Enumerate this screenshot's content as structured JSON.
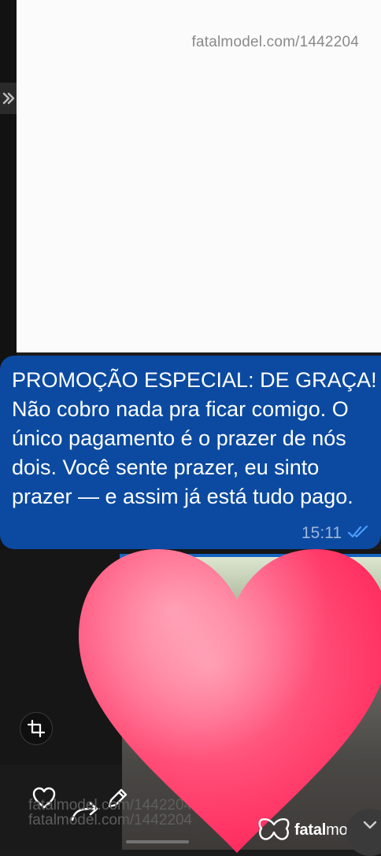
{
  "top_image": {
    "watermark": "fatalmodel.com/1442204"
  },
  "message": {
    "text": "PROMOÇÃO ESPECIAL: DE GRAÇA! Não cobro nada pra ficar comigo. O único pagamento é o prazer de nós dois. Você sente prazer, eu sinto prazer — e assim já está tudo pago.",
    "time": "15:11",
    "status_icon": "double-check-icon",
    "bubble_color": "#0b4aa0",
    "tick_color": "#4d9cff"
  },
  "media": {
    "watermark_line1": "fatalmodel.com/1442204",
    "watermark_line2": "fatalmodel.com/1442204",
    "sticker": "heart-sticker",
    "sticker_color": "#ff3d6e"
  },
  "toolbar": {
    "crop_icon": "crop-icon",
    "like_icon": "heart-outline-icon",
    "forward_icon": "forward-icon",
    "edit_icon": "pencil-icon"
  },
  "brand": {
    "name_bold": "fatal",
    "name_light": "model",
    "logo_icon": "butterfly-icon"
  },
  "nav": {
    "left_icon": "double-chevron-right-icon",
    "corner_icon": "chevron-down-icon"
  }
}
